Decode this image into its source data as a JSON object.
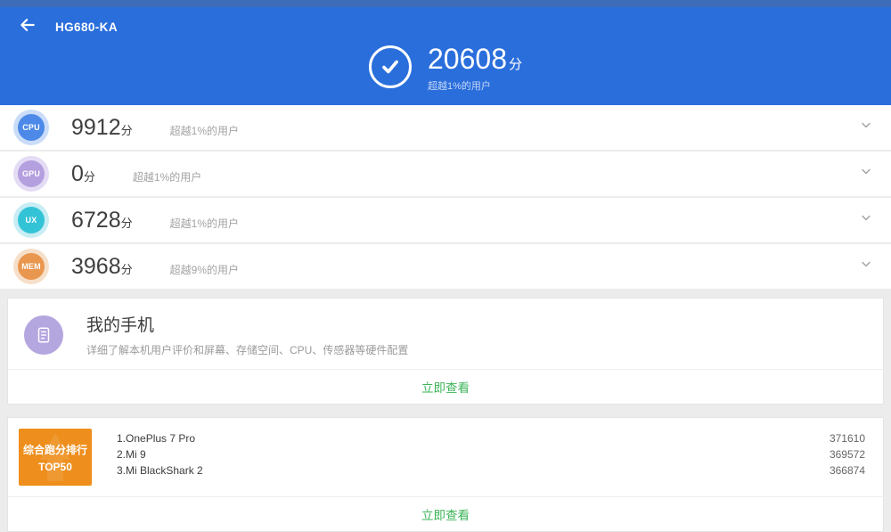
{
  "header": {
    "title": "HG680-KA",
    "score": "20608",
    "score_unit": "分",
    "score_note": "超越1%的用户"
  },
  "score_rows": [
    {
      "label": "CPU",
      "score": "9912",
      "unit": "分",
      "note": "超越1%的用户",
      "color": "#4d89e8",
      "ring": "#cadcf8"
    },
    {
      "label": "GPU",
      "score": "0",
      "unit": "分",
      "note": "超越1%的用户",
      "color": "#b49fdf",
      "ring": "#e4dcf5"
    },
    {
      "label": "UX",
      "score": "6728",
      "unit": "分",
      "note": "超越1%的用户",
      "color": "#33c3d6",
      "ring": "#c8edf4"
    },
    {
      "label": "MEM",
      "score": "3968",
      "unit": "分",
      "note": "超越9%的用户",
      "color": "#e9964f",
      "ring": "#f6dfc9"
    }
  ],
  "my_phone": {
    "title": "我的手机",
    "subtitle": "详细了解本机用户评价和屏幕、存储空间、CPU、传感器等硬件配置",
    "action": "立即查看"
  },
  "ranking": {
    "badge_line1": "综合跑分排行",
    "badge_line2": "TOP50",
    "items": [
      {
        "label": "1.OnePlus 7 Pro",
        "score": "371610"
      },
      {
        "label": "2.Mi 9",
        "score": "369572"
      },
      {
        "label": "3.Mi BlackShark 2",
        "score": "366874"
      }
    ],
    "action": "立即查看"
  },
  "colors": {
    "header_blue": "#2a6edc",
    "status_bar_blue": "#3f6cb9",
    "action_green": "#3eb45a",
    "badge_orange": "#ee8e1c",
    "background_gray": "#ececec"
  }
}
